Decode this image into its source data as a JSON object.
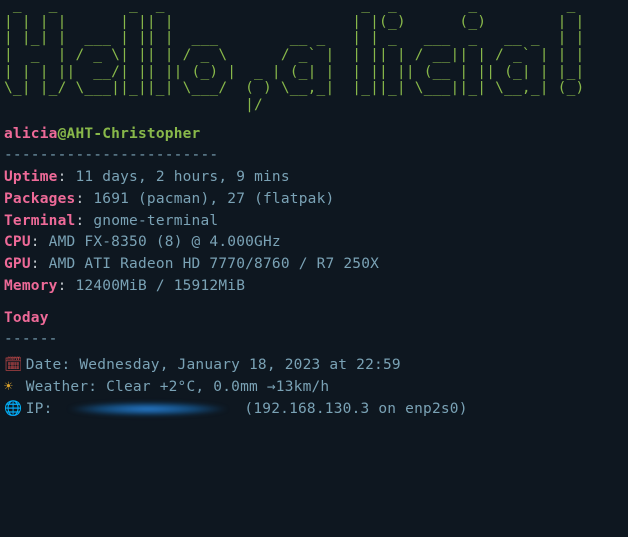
{
  "ascii": " _   _        _  _                      _  _        _          _ \n| | | |      | || |                    | |(_)      (_)        | |\n| |_| |  ___ | || |  ___        __ _   | | _   ___  _   __ _  | |\n|  _  | / _ \\| || | / _ \\      / _` |  | || | / __|| | / _` | | |\n| | | ||  __/| || || (_) |  _ | (_| |  | || || (__ | || (_| | |_|\n\\_| |_/ \\___||_||_| \\___/  ( ) \\__,_|  |_||_| \\___||_| \\__,_| (_)\n                           |/                                    ",
  "user": "alicia",
  "host": "AHT-Christopher",
  "host_sep": "------------------------",
  "info": {
    "uptime": {
      "label": "Uptime",
      "value": "11 days, 2 hours, 9 mins"
    },
    "packages": {
      "label": "Packages",
      "value": "1691 (pacman), 27 (flatpak)"
    },
    "terminal": {
      "label": "Terminal",
      "value": "gnome-terminal"
    },
    "cpu": {
      "label": "CPU",
      "value": "AMD FX-8350 (8) @ 4.000GHz"
    },
    "gpu": {
      "label": "GPU",
      "value": "AMD ATI Radeon HD 7770/8760 / R7 250X"
    },
    "memory": {
      "label": "Memory",
      "value": "12400MiB / 15912MiB"
    }
  },
  "today_heading": "Today",
  "today_sep": "------",
  "date_line": "Date: Wednesday, January 18, 2023 at 22:59",
  "weather_line": "Weather: Clear +2°C, 0.0mm →13km/h",
  "ip_prefix": "IP: ",
  "ip_rest": " (192.168.130.3 on enp2s0)",
  "icons": {
    "cal": "🗓",
    "sun": "☀",
    "globe": "🌐"
  }
}
